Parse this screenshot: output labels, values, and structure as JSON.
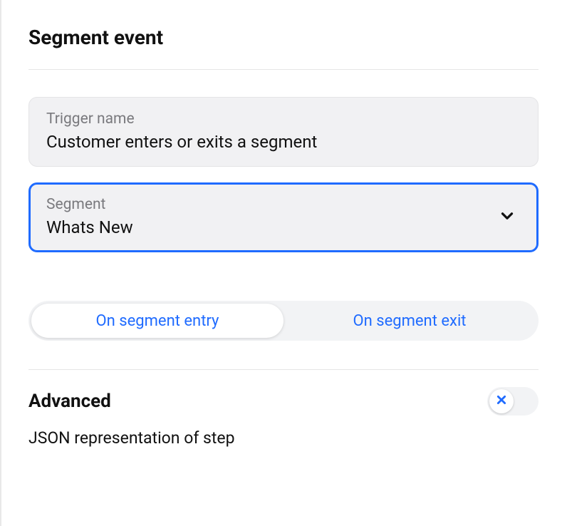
{
  "header": {
    "title": "Segment event"
  },
  "trigger": {
    "label": "Trigger name",
    "value": "Customer enters or exits a segment"
  },
  "segment": {
    "label": "Segment",
    "value": "Whats New"
  },
  "toggle": {
    "entry": "On segment entry",
    "exit": "On segment exit"
  },
  "advanced": {
    "title": "Advanced",
    "description": "JSON representation of step"
  }
}
